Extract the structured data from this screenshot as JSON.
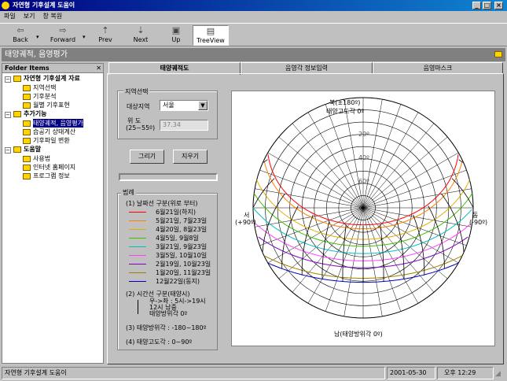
{
  "window": {
    "title": "자연형 기후설계 도움이"
  },
  "menu": [
    "파일",
    "보기",
    "창 복원"
  ],
  "toolbar": {
    "back": "Back",
    "forward": "Forward",
    "prev": "Prev",
    "next": "Next",
    "up": "Up",
    "treeview": "TreeView"
  },
  "header": {
    "title": "태양궤적, 음영평가"
  },
  "folder": {
    "title": "Folder Items",
    "groups": [
      {
        "label": "자연형 기후설계 자료",
        "items": [
          "지역선택",
          "기후분석",
          "월별 기후표현"
        ]
      },
      {
        "label": "추가기능",
        "items": [
          "태양궤적, 음영평가",
          "습공기 상태계산",
          "기후파일 변환"
        ]
      },
      {
        "label": "도움말",
        "items": [
          "사용법",
          "인터넷 홈페이지",
          "프로그램 정보"
        ]
      }
    ],
    "selected": "태양궤적, 음영평가"
  },
  "tabs": [
    "태양궤적도",
    "음영각 정보입력",
    "음영마스크"
  ],
  "region": {
    "group": "지역선택",
    "target_label": "대상지역",
    "target_value": "서울",
    "lat_label": "위 도",
    "lat_range": "(25~55º)",
    "lat_value": "37.34"
  },
  "buttons": {
    "draw": "그리기",
    "clear": "지우기"
  },
  "legend": {
    "title": "범례",
    "section1": "(1) 날짜선 구분(위로 부터)",
    "dates": [
      {
        "label": "6월21일(하지)",
        "color": "#ff0000"
      },
      {
        "label": "5월21일, 7월23일",
        "color": "#ff8000"
      },
      {
        "label": "4월20일, 8월23일",
        "color": "#e0b000"
      },
      {
        "label": "4월5일, 9월8일",
        "color": "#40c000"
      },
      {
        "label": "3월21일, 9월23일",
        "color": "#00c0c0"
      },
      {
        "label": "3월5일, 10월10일",
        "color": "#ff40ff"
      },
      {
        "label": "2월19일, 10월23일",
        "color": "#8000c0"
      },
      {
        "label": "1월20일, 11월23일",
        "color": "#a08000"
      },
      {
        "label": "12월22일(동지)",
        "color": "#0000c0"
      }
    ],
    "section2": "(2) 시간선 구분(태양시)",
    "time_desc": [
      "우->좌 : 5시->19시",
      "12시 남중",
      "태양방위각 0º"
    ],
    "section3": "(3) 태양방위각 : -180~180º",
    "section4": "(4) 태양고도각 : 0~90º"
  },
  "chart": {
    "north": "북(±180º)",
    "north_alt": "태양고도각 0º",
    "south": "남(태양방위각 0º)",
    "west": "서",
    "west_deg": "(+90º)",
    "east": "동",
    "east_deg": "(-90º)",
    "alt_labels": [
      "20º",
      "40º",
      "60º"
    ]
  },
  "status": {
    "text": "자연형 기후설계 도움이",
    "date": "2001-05-30",
    "time": "오후 12:29"
  }
}
